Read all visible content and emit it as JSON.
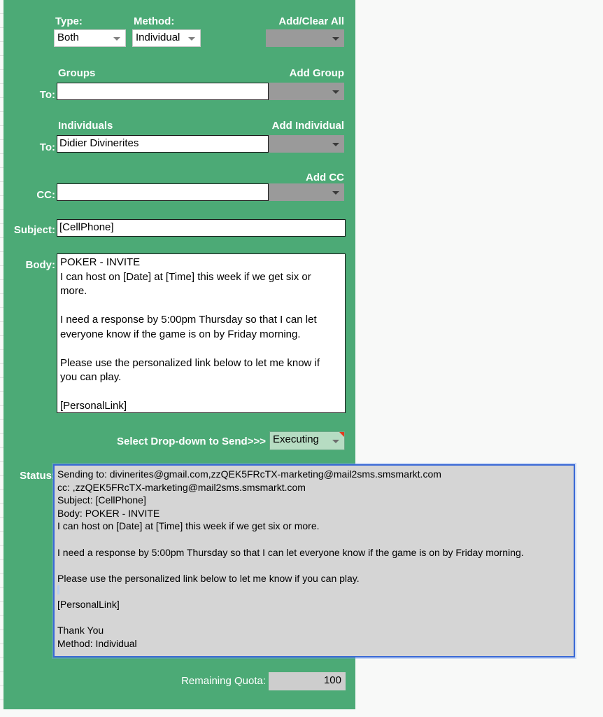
{
  "panel": {
    "background_color": "#4caa76",
    "page_background_color": "#f8f9f8"
  },
  "toolbar": {
    "type_label": "Type:",
    "type_value": "Both",
    "method_label": "Method:",
    "method_value": "Individual",
    "add_clear_all_label": "Add/Clear All",
    "add_clear_all_value": ""
  },
  "groups": {
    "header": "Groups",
    "to_label": "To:",
    "value": "",
    "add_button_label": "Add Group",
    "add_button_value": ""
  },
  "individuals": {
    "header": "Individuals",
    "to_label": "To:",
    "value": "Didier Divinerites",
    "add_button_label": "Add Individual",
    "add_button_value": ""
  },
  "cc": {
    "label": "CC:",
    "value": "",
    "add_button_label": "Add CC",
    "add_button_value": ""
  },
  "subject": {
    "label": "Subject:",
    "value": "[CellPhone]"
  },
  "body": {
    "label": "Body:",
    "value": "POKER - INVITE\nI can host on [Date] at [Time] this week if we get six or\nmore.\n\nI need a response by 5:00pm Thursday so that I can let\neveryone know if the game is on by Friday morning.\n\nPlease use the personalized link below to let me know if\nyou can play.\n\n[PersonalLink]"
  },
  "send": {
    "prompt_label": "Select Drop-down to Send>>>",
    "selected_value": "Executing",
    "note_marker_color": "#e23b1e"
  },
  "status": {
    "label": "Status:",
    "border_color": "#3a69d6",
    "value": "Sending to: divinerites@gmail.com,zzQEK5FRcTX-marketing@mail2sms.smsmarkt.com\ncc: ,zzQEK5FRcTX-marketing@mail2sms.smsmarkt.com\nSubject: [CellPhone]\nBody: POKER - INVITE\nI can host on [Date] at [Time] this week if we get six or more.\n\nI need a response by 5:00pm Thursday so that I can let everyone know if the game is on by Friday morning.\n\nPlease use the personalized link below to let me know if you can play.\n\n[PersonalLink]\n\nThank You\nMethod: Individual"
  },
  "quota": {
    "label": "Remaining Quota:",
    "value": "100"
  }
}
